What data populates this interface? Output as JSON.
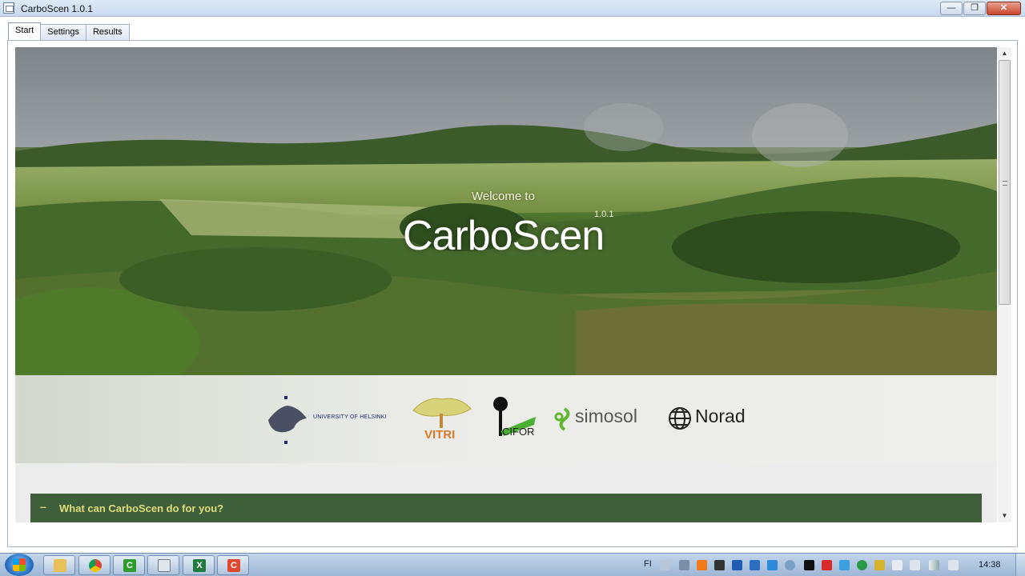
{
  "window": {
    "title": "CarboScen 1.0.1",
    "min": "—",
    "max": "❐",
    "close": "✕"
  },
  "tabs": [
    {
      "label": "Start",
      "active": true
    },
    {
      "label": "Settings",
      "active": false
    },
    {
      "label": "Results",
      "active": false
    }
  ],
  "hero": {
    "welcome": "Welcome to",
    "brand": "CarboScen",
    "version": "1.0.1"
  },
  "logos": {
    "helsinki": "UNIVERSITY OF HELSINKI",
    "vitri": "VITRI",
    "cifor": "CIFOR",
    "simosol": "simosol",
    "norad": "Norad"
  },
  "section": {
    "toggle": "–",
    "label": "What can CarboScen do for you?"
  },
  "scrollbar": {
    "up": "▲",
    "down": "▼"
  },
  "taskbar": {
    "apps": [
      "explorer",
      "chrome",
      "carboscen-green",
      "notepad",
      "excel",
      "carboscen-red"
    ],
    "language": "FI",
    "clock": "14:38"
  },
  "colors": {
    "section_bg": "#3f5f3a",
    "section_text": "#e1dc7e",
    "vitri": "#d9782c",
    "helsinki": "#1c2a79"
  }
}
